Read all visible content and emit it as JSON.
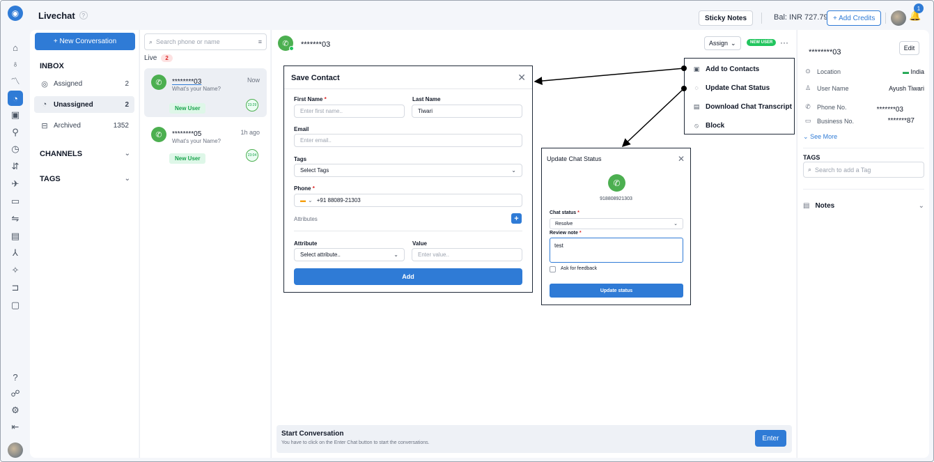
{
  "app": {
    "title": "Livechat"
  },
  "topbar": {
    "sticky_notes": "Sticky Notes",
    "balance": "Bal: INR 727.79",
    "add_credits": "+ Add Credits",
    "notification_count": "1"
  },
  "inbox": {
    "new_conversation": "+ New Conversation",
    "heading": "INBOX",
    "items": [
      {
        "label": "Assigned",
        "count": "2",
        "icon": "user-circle-icon"
      },
      {
        "label": "Unassigned",
        "count": "2",
        "icon": "chat-bubble-icon"
      },
      {
        "label": "Archived",
        "count": "1352",
        "icon": "archive-icon"
      }
    ],
    "channels": "CHANNELS",
    "tags": "TAGS"
  },
  "list": {
    "search_placeholder": "Search phone or name",
    "live_label": "Live",
    "live_count": "2",
    "conversations": [
      {
        "number": "********03",
        "message": "What's your Name?",
        "time": "Now",
        "badge": "New User",
        "timer": "23:29"
      },
      {
        "number": "********05",
        "message": "What's your Name?",
        "time": "1h ago",
        "badge": "New User",
        "timer": "23:04"
      }
    ]
  },
  "chat": {
    "number": "*******03",
    "assign": "Assign",
    "new_user_badge": "NEW USER",
    "start_title": "Start Conversation",
    "start_sub": "You have to click on the Enter Chat button to start the conversations.",
    "enter": "Enter"
  },
  "info": {
    "number": "********03",
    "edit": "Edit",
    "rows": [
      {
        "key": "Location",
        "value": "India",
        "icon": "location-pin-icon"
      },
      {
        "key": "User Name",
        "value": "Ayush Tiwari",
        "icon": "user-icon"
      },
      {
        "key": "Phone No.",
        "value": "*******03",
        "icon": "phone-icon"
      },
      {
        "key": "Business No.",
        "value": "*******87",
        "icon": "briefcase-icon"
      }
    ],
    "see_more": "See More",
    "tags_title": "TAGS",
    "tag_search_placeholder": "Search to add a Tag",
    "notes": "Notes"
  },
  "save_contact": {
    "title": "Save Contact",
    "first_name_label": "First Name",
    "first_name_placeholder": "Enter first name..",
    "last_name_label": "Last Name",
    "last_name_value": "Tiwari",
    "email_label": "Email",
    "email_placeholder": "Enter email..",
    "tags_label": "Tags",
    "tags_value": "Select Tags",
    "phone_label": "Phone",
    "phone_value": "+91 88089-21303",
    "attributes_label": "Attributes",
    "attribute_label": "Attribute",
    "attribute_value": "Select attribute..",
    "value_label": "Value",
    "value_placeholder": "Enter value..",
    "add": "Add"
  },
  "menu": {
    "items": [
      {
        "label": "Add to Contacts",
        "icon": "contact-card-icon"
      },
      {
        "label": "Update Chat Status",
        "icon": "refresh-icon"
      },
      {
        "label": "Download Chat Transcript",
        "icon": "transcript-icon"
      },
      {
        "label": "Block",
        "icon": "block-icon"
      }
    ]
  },
  "update_status": {
    "title": "Update Chat Status",
    "phone": "918808921303",
    "status_label": "Chat status",
    "status_value": "Resolve",
    "note_label": "Review note",
    "note_value": "test",
    "feedback": "Ask for feedback",
    "submit": "Update status"
  },
  "colors": {
    "accent": "#2f7bd6",
    "whatsapp": "#4caf50",
    "live_pill": "#dc2626"
  }
}
